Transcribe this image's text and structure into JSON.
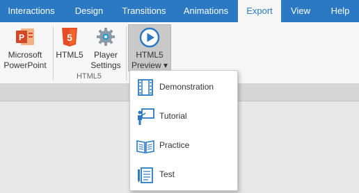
{
  "tabs": [
    {
      "label": "Interactions",
      "active": false
    },
    {
      "label": "Design",
      "active": false
    },
    {
      "label": "Transitions",
      "active": false
    },
    {
      "label": "Animations",
      "active": false
    },
    {
      "label": "Export",
      "active": true
    },
    {
      "label": "View",
      "active": false
    },
    {
      "label": "Help",
      "active": false
    }
  ],
  "ribbon": {
    "powerpoint": {
      "label": "Microsoft\nPowerPoint",
      "icon": "powerpoint-icon"
    },
    "html5": {
      "label": "HTML5",
      "icon": "html5-icon"
    },
    "player_settings": {
      "label": "Player\nSettings",
      "icon": "gear-icon"
    },
    "html5_preview": {
      "label": "HTML5\nPreview ▾",
      "icon": "play-icon"
    },
    "group_label": "HTML5"
  },
  "preview_menu": {
    "items": [
      {
        "label": "Demonstration",
        "icon": "film-icon"
      },
      {
        "label": "Tutorial",
        "icon": "presenter-icon"
      },
      {
        "label": "Practice",
        "icon": "book-icon"
      },
      {
        "label": "Test",
        "icon": "test-icon"
      }
    ]
  },
  "colors": {
    "accent": "#2b79c2",
    "ribbon_bg": "#f7f7f7",
    "powerpoint": "#d24726",
    "html5": "#e44d26"
  }
}
